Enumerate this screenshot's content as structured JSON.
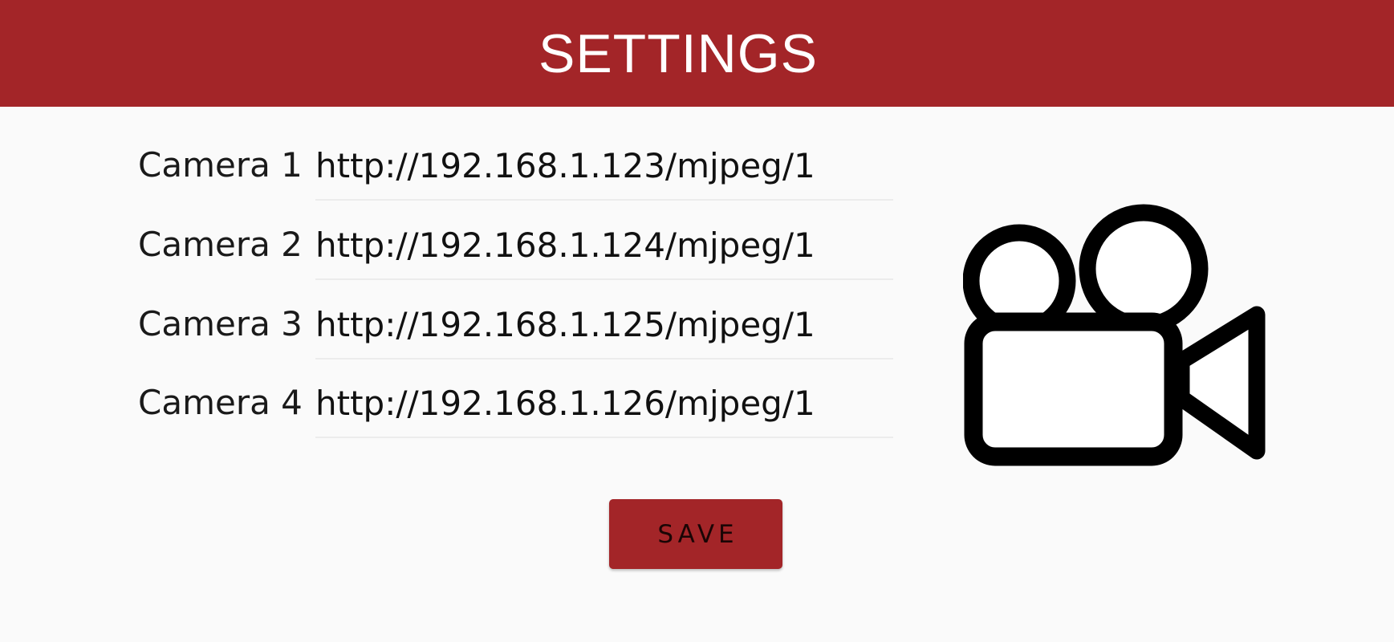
{
  "header": {
    "title": "SETTINGS",
    "background_color": "#a32528",
    "title_color": "#ffffff"
  },
  "cameras": [
    {
      "label": "Camera 1",
      "url": "http://192.168.1.123/mjpeg/1"
    },
    {
      "label": "Camera 2",
      "url": "http://192.168.1.124/mjpeg/1"
    },
    {
      "label": "Camera 3",
      "url": "http://192.168.1.125/mjpeg/1"
    },
    {
      "label": "Camera 4",
      "url": "http://192.168.1.126/mjpeg/1"
    }
  ],
  "save_button": {
    "label": "SAVE",
    "color": "#a32528"
  },
  "illustration": {
    "icon": "video-camera-icon"
  }
}
